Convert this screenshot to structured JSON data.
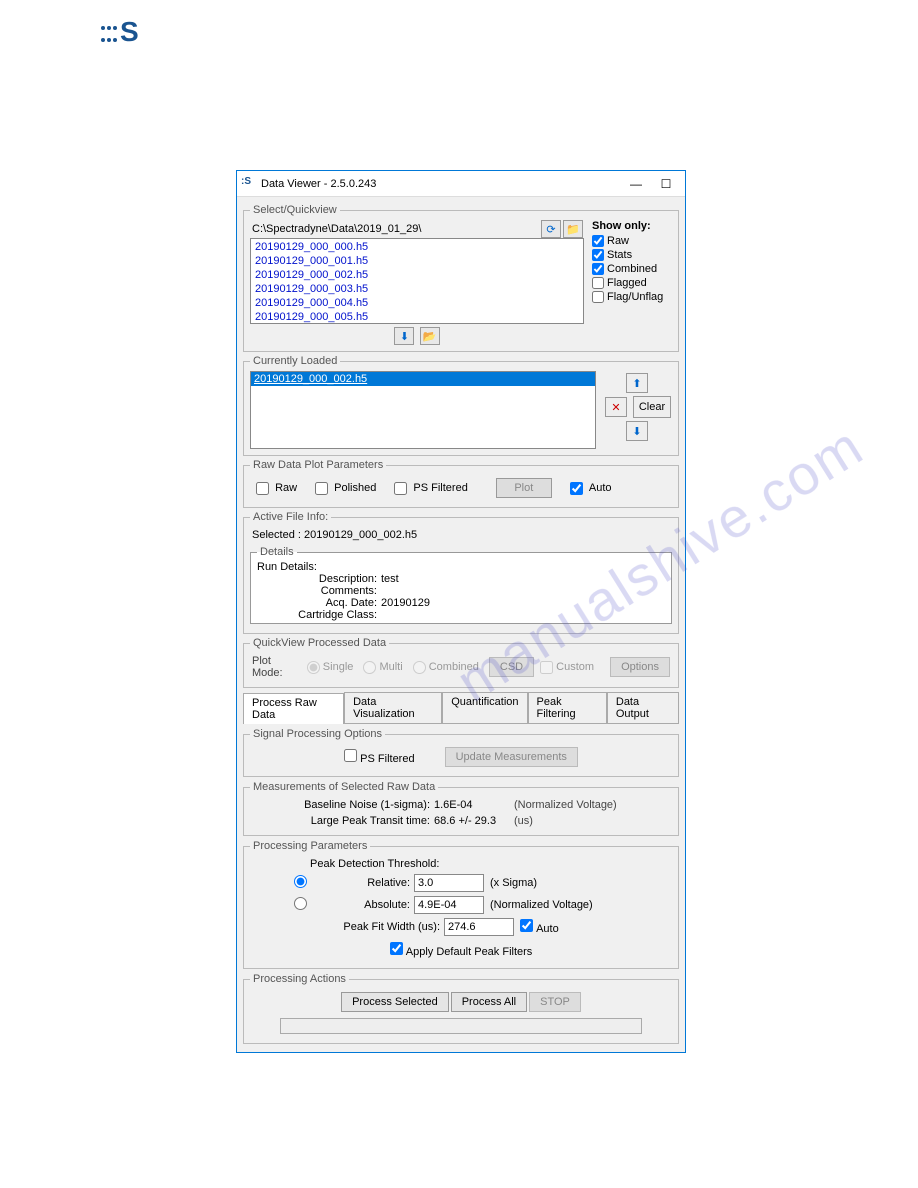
{
  "window": {
    "title": "Data Viewer - 2.5.0.243"
  },
  "quickview": {
    "legend": "Select/Quickview",
    "path": "C:\\Spectradyne\\Data\\2019_01_29\\",
    "files": [
      "20190129_000_000.h5",
      "20190129_000_001.h5",
      "20190129_000_002.h5",
      "20190129_000_003.h5",
      "20190129_000_004.h5",
      "20190129_000_005.h5"
    ],
    "show_only": {
      "title": "Show only:",
      "raw": "Raw",
      "stats": "Stats",
      "combined": "Combined",
      "flagged": "Flagged",
      "flag_unflag": "Flag/Unflag"
    }
  },
  "loaded": {
    "legend": "Currently Loaded",
    "items": [
      "20190129_000_002.h5"
    ],
    "clear": "Clear"
  },
  "plot_params": {
    "legend": "Raw Data Plot Parameters",
    "raw": "Raw",
    "polished": "Polished",
    "ps_filtered": "PS Filtered",
    "plot": "Plot",
    "auto": "Auto"
  },
  "active_file": {
    "legend": "Active File Info:",
    "selected_label": "Selected :",
    "selected_value": "20190129_000_002.h5",
    "details_legend": "Details",
    "run_label": "Run Details:",
    "description_label": "Description:",
    "description_value": "test",
    "comments_label": "Comments:",
    "comments_value": "",
    "acq_date_label": "Acq. Date:",
    "acq_date_value": "20190129",
    "cartridge_label": "Cartridge Class:"
  },
  "quickview_processed": {
    "legend": "QuickView Processed Data",
    "plot_mode_label": "Plot Mode:",
    "single": "Single",
    "multi": "Multi",
    "combined": "Combined",
    "csd": "CSD",
    "custom": "Custom",
    "options": "Options"
  },
  "tabs": {
    "process": "Process Raw Data",
    "dataviz": "Data Visualization",
    "quant": "Quantification",
    "peak": "Peak Filtering",
    "output": "Data Output"
  },
  "signal": {
    "legend": "Signal Processing Options",
    "ps_filtered": "PS Filtered",
    "update": "Update Measurements"
  },
  "measurements": {
    "legend": "Measurements of Selected Raw Data",
    "baseline_label": "Baseline Noise (1-sigma):",
    "baseline_value": "1.6E-04",
    "baseline_unit": "(Normalized Voltage)",
    "transit_label": "Large Peak Transit time:",
    "transit_value": "68.6 +/- 29.3",
    "transit_unit": "(us)"
  },
  "processing_params": {
    "legend": "Processing Parameters",
    "threshold_label": "Peak Detection Threshold:",
    "relative_label": "Relative:",
    "relative_value": "3.0",
    "relative_unit": "(x Sigma)",
    "absolute_label": "Absolute:",
    "absolute_value": "4.9E-04",
    "absolute_unit": "(Normalized Voltage)",
    "fit_width_label": "Peak Fit Width (us):",
    "fit_width_value": "274.6",
    "auto": "Auto",
    "apply_default": "Apply Default Peak Filters"
  },
  "actions": {
    "legend": "Processing Actions",
    "process_selected": "Process Selected",
    "process_all": "Process All",
    "stop": "STOP"
  },
  "watermark": "manualshive.com"
}
